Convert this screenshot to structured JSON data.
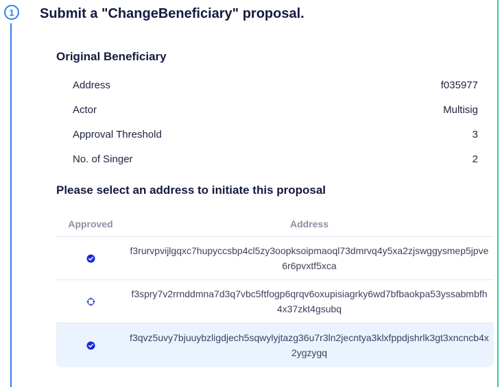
{
  "step": {
    "number": "1",
    "title": "Submit a \"ChangeBeneficiary\" proposal."
  },
  "original": {
    "title": "Original Beneficiary",
    "rows": [
      {
        "label": "Address",
        "value": "f035977"
      },
      {
        "label": "Actor",
        "value": "Multisig"
      },
      {
        "label": "Approval Threshold",
        "value": "3"
      },
      {
        "label": "No. of Singer",
        "value": "2"
      }
    ]
  },
  "select": {
    "title": "Please select an address to initiate this proposal",
    "columns": {
      "approved": "Approved",
      "address": "Address"
    },
    "rows": [
      {
        "address": "f3rurvpvijlgqxc7hupyccsbp4cl5zy3oopksoipmaoql73dmrvq4y5xa2zjswggysmep5jpve6r6pvxtf5xca",
        "approved": true,
        "selected": false,
        "icon": "check-circle-icon"
      },
      {
        "address": "f3spry7v2rrnddmna7d3q7vbc5ftfogp6qrqv6oxupisiagrky6wd7bfbaokpa53yssabmbfh4x37zkt4gsubq",
        "approved": false,
        "selected": false,
        "icon": "crosshair-icon"
      },
      {
        "address": "f3qvz5uvy7bjuuybzligdjech5sqwylyjtazg36u7r3ln2jecntya3klxfppdjshrlk3gt3xncncb4x2ygzygq",
        "approved": true,
        "selected": true,
        "icon": "check-circle-icon"
      }
    ]
  },
  "colors": {
    "accent": "#2f80ed",
    "navy": "#141a3f",
    "check": "#1a2bd6",
    "selected_bg": "#eaf3fe",
    "right_border": "#3ec9a0"
  }
}
